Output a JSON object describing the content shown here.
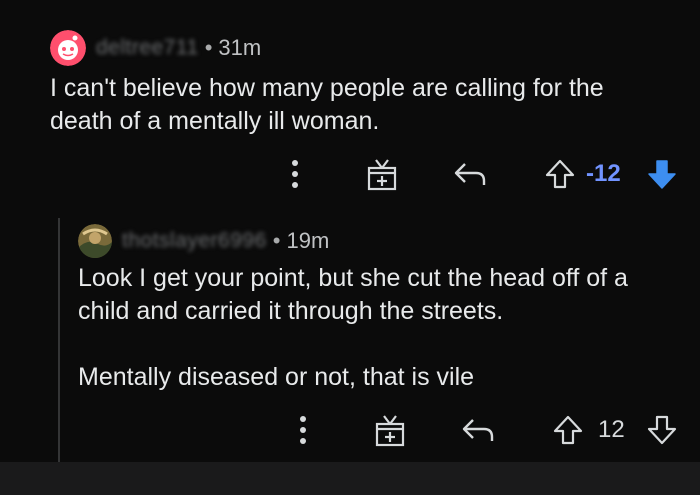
{
  "comments": [
    {
      "username": "deltree711",
      "time": "31m",
      "text": "I can't believe how many people are calling for the\ndeath of a mentally ill woman.",
      "score": "-12",
      "vote_state": "downvoted",
      "avatar_icon": "reddit-snoo-avatar",
      "colors": {
        "score": "#7193ff",
        "downvote": "#3d8ef0"
      }
    },
    {
      "username": "thotslayer6996",
      "time": "19m",
      "text": "Look I get your point, but she cut the head off of a\nchild and carried it through the streets.\n\nMentally diseased or not, that is vile",
      "score": "12",
      "vote_state": "none",
      "avatar_icon": "user-photo-avatar",
      "colors": {
        "score": "#d7dadc"
      }
    }
  ],
  "separator": "•"
}
